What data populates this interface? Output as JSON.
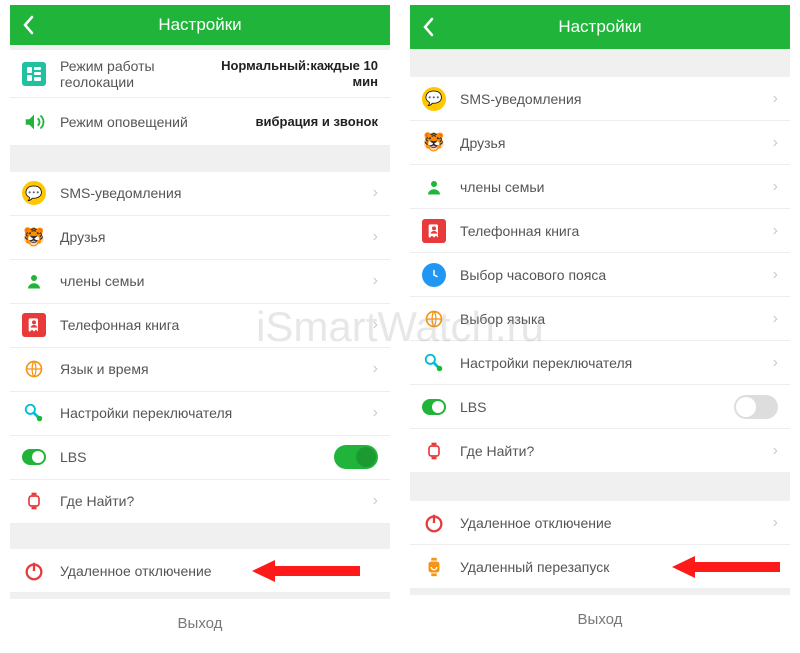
{
  "watermark": "iSmartWatch.ru",
  "left": {
    "title": "Настройки",
    "rows": [
      {
        "label": "Режим работы геолокации",
        "value": "Нормальный:каждые 10 мин"
      },
      {
        "label": "Режим оповещений",
        "value": "вибрация и звонок"
      }
    ],
    "items": [
      {
        "label": "SMS-уведомления"
      },
      {
        "label": "Друзья"
      },
      {
        "label": "члены семьи"
      },
      {
        "label": "Телефонная книга"
      },
      {
        "label": "Язык и время"
      },
      {
        "label": "Настройки переключателя"
      },
      {
        "label": "LBS"
      },
      {
        "label": "Где Найти?"
      }
    ],
    "power": {
      "label": "Удаленное отключение"
    },
    "exit": "Выход"
  },
  "right": {
    "title": "Настройки",
    "items": [
      {
        "label": "SMS-уведомления"
      },
      {
        "label": "Друзья"
      },
      {
        "label": "члены семьи"
      },
      {
        "label": "Телефонная книга"
      },
      {
        "label": "Выбор часового пояса"
      },
      {
        "label": "Выбор языка"
      },
      {
        "label": "Настройки переключателя"
      },
      {
        "label": "LBS"
      },
      {
        "label": "Где Найти?"
      }
    ],
    "power": [
      {
        "label": "Удаленное отключение"
      },
      {
        "label": "Удаленный перезапуск"
      }
    ],
    "exit": "Выход"
  },
  "colors": {
    "accent": "#20b53a",
    "red": "#e83a3a"
  }
}
